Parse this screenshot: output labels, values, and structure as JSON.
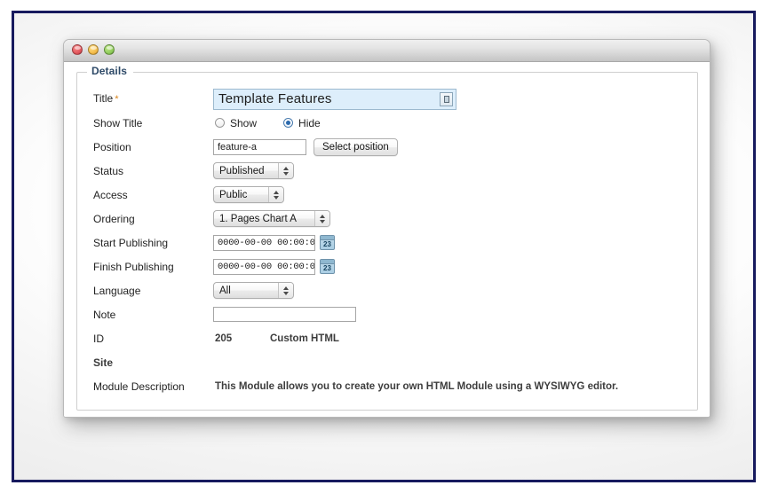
{
  "window": {
    "traffic_lights": [
      {
        "name": "close",
        "color": "#e2565c"
      },
      {
        "name": "minimize",
        "color": "#f3bb48"
      },
      {
        "name": "zoom",
        "color": "#8fcc5b"
      }
    ]
  },
  "fieldset": {
    "legend": "Details"
  },
  "form": {
    "title": {
      "label": "Title",
      "required_mark": "*",
      "value": "Template Features",
      "placeholder": "Title"
    },
    "show_title": {
      "label": "Show Title",
      "options": [
        {
          "label": "Show",
          "checked": false
        },
        {
          "label": "Hide",
          "checked": true
        }
      ]
    },
    "position": {
      "label": "Position",
      "value": "feature-a",
      "placeholder": "Position",
      "button_label": "Select position"
    },
    "status": {
      "label": "Status",
      "value": "Published"
    },
    "access": {
      "label": "Access",
      "value": "Public"
    },
    "ordering": {
      "label": "Ordering",
      "value": "1. Pages Chart A"
    },
    "start_publishing": {
      "label": "Start Publishing",
      "value": "0000-00-00 00:00:0",
      "calendar_day": "23"
    },
    "finish_publishing": {
      "label": "Finish Publishing",
      "value": "0000-00-00 00:00:0",
      "calendar_day": "23"
    },
    "language": {
      "label": "Language",
      "value": "All"
    },
    "note": {
      "label": "Note",
      "value": "",
      "placeholder": ""
    },
    "id": {
      "label": "ID",
      "value": "205",
      "module_type": "Custom HTML"
    },
    "site": {
      "label": "Site"
    },
    "module_description": {
      "label": "Module Description",
      "value": "This Module allows you to create your own HTML Module using a WYSIWYG editor."
    }
  },
  "colors": {
    "frame_border": "#171a5e",
    "legend_text": "#2e4a68",
    "required_asterisk": "#d8841c",
    "title_field_bg": "#ddeefb",
    "radio_selected": "#2a69ad"
  }
}
